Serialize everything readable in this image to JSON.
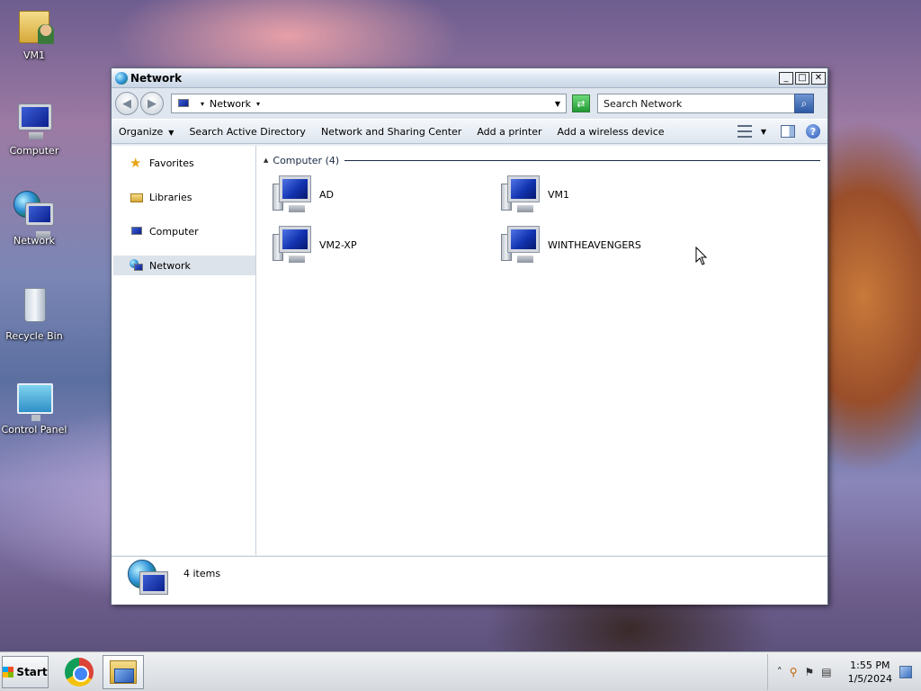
{
  "desktop": {
    "icons": [
      {
        "label": "VM1",
        "icon": "user-folder-icon"
      },
      {
        "label": "Computer",
        "icon": "computer-icon"
      },
      {
        "label": "Network",
        "icon": "network-icon"
      },
      {
        "label": "Recycle Bin",
        "icon": "recycle-bin-icon"
      },
      {
        "label": "Control Panel",
        "icon": "control-panel-icon"
      }
    ]
  },
  "window": {
    "title": "Network",
    "controls": {
      "minimize": "_",
      "maximize": "□",
      "close": "✕"
    }
  },
  "address": {
    "location": "Network",
    "search_placeholder": "Search Network"
  },
  "commands": {
    "organize": "Organize",
    "search_ad": "Search Active Directory",
    "sharing_center": "Network and Sharing Center",
    "add_printer": "Add a printer",
    "add_wireless": "Add a wireless device"
  },
  "nav": {
    "favorites": "Favorites",
    "libraries": "Libraries",
    "computer": "Computer",
    "network": "Network"
  },
  "content": {
    "group_label": "Computer (4)",
    "items": [
      "AD",
      "VM1",
      "VM2-XP",
      "WINTHEAVENGERS"
    ]
  },
  "details": {
    "count": "4 items"
  },
  "taskbar": {
    "start_label": "Start",
    "time": "1:55 PM",
    "date": "1/5/2024"
  },
  "colors": {
    "accent": "#2b5aa5",
    "nav_selected": "#dde3ea"
  }
}
